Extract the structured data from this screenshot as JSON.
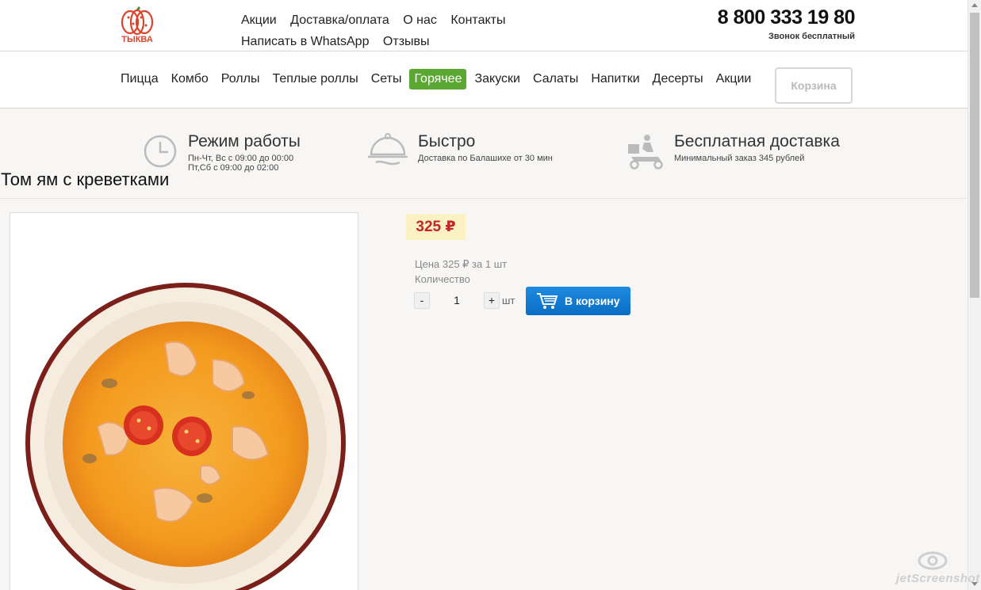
{
  "header": {
    "logo_text": "ТЫКВА",
    "nav": [
      "Акции",
      "Доставка/оплата",
      "О нас",
      "Контакты",
      "Написать в WhatsApp",
      "Отзывы"
    ],
    "phone": "8 800 333 19 80",
    "phone_note": "Звонок бесплатный"
  },
  "menu": {
    "items": [
      "Пицца",
      "Комбо",
      "Роллы",
      "Теплые роллы",
      "Сеты",
      "Горячее",
      "Закуски",
      "Салаты",
      "Напитки",
      "Десерты",
      "Акции"
    ],
    "active": "Горячее",
    "cart_label": "Корзина"
  },
  "info": {
    "hours": {
      "title": "Режим работы",
      "line1": "Пн-Чт, Вс с 09:00 до 00:00",
      "line2": "Пт,Сб с 09:00 до 02:00",
      "icon": "clock-icon"
    },
    "fast": {
      "title": "Быстро",
      "line1": "Доставка по Балашихе от 30 мин",
      "icon": "cloche-icon"
    },
    "delivery": {
      "title": "Бесплатная доставка",
      "line1": "Минимальный заказ 345 рублей",
      "icon": "courier-scooter-icon"
    }
  },
  "product": {
    "title": "Том ям с креветками",
    "price": "325 ₽",
    "unit_price": "Цена 325 ₽ за 1 шт",
    "qty_label": "Количество",
    "qty_value": "1",
    "qty_minus": "-",
    "qty_plus": "+",
    "qty_unit": "шт",
    "add_to_cart": "В корзину",
    "image_alt": "soup-bowl-image"
  },
  "watermark": "jetScreenshot",
  "colors": {
    "accent_green": "#5aa832",
    "price_red": "#c0282d",
    "price_bg": "#fbf2c3",
    "button_blue": "#0a6dc4"
  }
}
